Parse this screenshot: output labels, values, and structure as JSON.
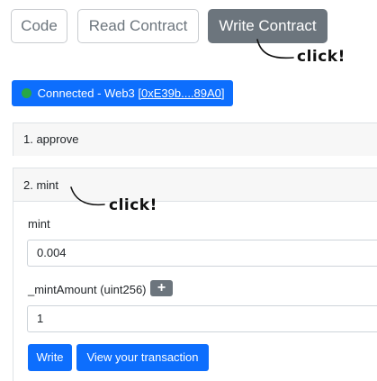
{
  "tabs": {
    "code": "Code",
    "read_contract": "Read Contract",
    "write_contract": "Write Contract"
  },
  "annotations": {
    "click_1": "click!",
    "click_2": "click!"
  },
  "wallet": {
    "status_prefix": "Connected - Web3 ",
    "address_link": "[0xE39b....89A0]",
    "status_color": "#28a745",
    "accent": "#0d6efd"
  },
  "functions": [
    {
      "label": "1. approve"
    },
    {
      "label": "2. mint",
      "payable_label": "mint",
      "payable_value": "0.004",
      "param_label": "_mintAmount (uint256)",
      "param_value": "1",
      "add_button": "+",
      "write_button": "Write",
      "view_tx_button": "View your transaction"
    }
  ]
}
